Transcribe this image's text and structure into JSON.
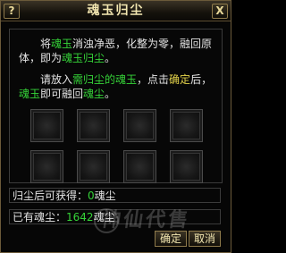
{
  "window": {
    "title": "魂玉归尘",
    "help_label": "?",
    "close_label": "X"
  },
  "description": {
    "p1_a": "将",
    "p1_b": "魂玉",
    "p1_c": "消浊净恶，化整为零，融回原体，即为",
    "p1_d": "魂玉归尘",
    "p1_e": "。",
    "p2_a": "请放入",
    "p2_b": "需归尘的魂玉",
    "p2_c": "，点击",
    "p2_d": "确定",
    "p2_e": "后，",
    "p2_f": "魂玉",
    "p2_g": "即可融回",
    "p2_h": "魂尘",
    "p2_i": "。"
  },
  "slots_count": 8,
  "obtain": {
    "label": "归尘后可获得：",
    "value": "0",
    "unit": "魂尘"
  },
  "owned": {
    "label": "已有魂尘：",
    "value": "1642",
    "unit": "魂尘"
  },
  "buttons": {
    "confirm": "确定",
    "cancel": "取消"
  },
  "watermark_text": "神仙代售",
  "colors": {
    "highlight_green": "#35d338",
    "highlight_yellow": "#e3d24a"
  }
}
